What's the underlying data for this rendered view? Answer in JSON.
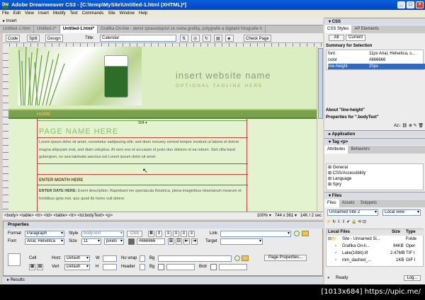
{
  "app": {
    "title": "Adobe Dreamweaver CS3 - [C:\\temp\\MySite\\Untitled-1.html (XHTML)*]",
    "menu": [
      "File",
      "Edit",
      "View",
      "Insert",
      "Modify",
      "Text",
      "Commands",
      "Site",
      "Window",
      "Help"
    ],
    "insert_bar": "Insert"
  },
  "doc_tabs": [
    {
      "label": "Untitled-1.html"
    },
    {
      "label": "Untitled-2*"
    },
    {
      "label": "Untitled-1.html*"
    },
    {
      "label": "Grafika On-line - denni zpravodajstvi ze sveta grafiky, polygrafie a digitalni fotografie h"
    }
  ],
  "doc_toolbar": {
    "code": "Code",
    "split": "Split",
    "design": "Design",
    "title_label": "Title:",
    "title_value": "Calendar",
    "check_page": "Check Page"
  },
  "page": {
    "site_name": "insert website name",
    "tagline": "OPTIONAL TAGLINE HERE",
    "nav_home": "HOME",
    "width_readout": "504 ▾",
    "page_name": "PAGE NAME HERE",
    "lorem": "Lorem ipsum dolor sit amet, consetetur sadipscing elitr, sed diam nonumy eirmod tempor invidunt ut labore et dolore magna aliquyam erat, sed diam voluptua. At vero eos et accusam et justo duo dolores et ea rebum. Stet clita kasd gubergren, no sea takimata sanctus est Lorem ipsum dolor sit amet.",
    "month_head": "ENTER MONTH HERE",
    "date_label": "ENTER DATE HERE:",
    "date_text": "Event description. Rapiebant me spectacula theatrica, plena imaginibus miseriarum mearum et fomitibus ignis mei. quo quod ibi homo vult dolere"
  },
  "status": {
    "tags": "<body> <table> <tr> <td> <table> <tr> <td.bodyText> <p>",
    "zoom": "100%",
    "size": "744 x 361",
    "weight": "14K / 2 sec"
  },
  "properties": {
    "title": "Properties",
    "format_label": "Format",
    "format": "Paragraph",
    "style_label": "Style",
    "style": "bodyText",
    "css_btn": "CSS",
    "link_label": "Link",
    "font_label": "Font",
    "font": "Arial, Helvetica",
    "size_label": "Size",
    "size": "11",
    "unit": "pixels",
    "color": "#666666",
    "target_label": "Target",
    "cell_label": "Cell",
    "horz_label": "Horz",
    "horz": "Default",
    "w_label": "W",
    "nowrap_label": "No wrap",
    "bg_label": "Bg",
    "page_props": "Page Properties...",
    "vert_label": "Vert",
    "vert": "Default",
    "h_label": "H",
    "header_label": "Header",
    "bg2_label": "Bg",
    "brdr_label": "Brdr",
    "results": "Results"
  },
  "css_panel": {
    "title": "CSS",
    "tabs": [
      "CSS Styles",
      "AP Elements"
    ],
    "mode": [
      "All",
      "Current"
    ],
    "summary_title": "Summary for Selection",
    "summary": [
      {
        "k": "font",
        "v": "11px Arial, Helvetica, s..."
      },
      {
        "k": "color",
        "v": "#666666"
      },
      {
        "k": "line-height",
        "v": "20px"
      }
    ],
    "about": "About \"line-height\"",
    "props_for": "Properties for \".bodyText\""
  },
  "application_panel": "Application",
  "tag_panel": {
    "title": "Tag <p>",
    "tabs": [
      "Attributes",
      "Behaviors"
    ],
    "groups": [
      "General",
      "CSS/Accessibility",
      "Language",
      "Spry"
    ]
  },
  "files_panel": {
    "title": "Files",
    "tabs": [
      "Files",
      "Assets",
      "Snippets"
    ],
    "site": "Unnamed Site 2",
    "view": "Local view",
    "headers": [
      "Local Files",
      "Size",
      "Type"
    ],
    "rows": [
      {
        "name": "Site - Unnamed Si...",
        "size": "",
        "type": "Folde"
      },
      {
        "name": "Grafika On-li...",
        "size": "94KB",
        "type": "Oper"
      },
      {
        "name": "Lake(16bit).tif",
        "size": "2.47MB",
        "type": "TIF I"
      },
      {
        "name": "mm_dashed_...",
        "size": "1KB",
        "type": "GIF I"
      }
    ],
    "status": "Ready",
    "log": "Log..."
  },
  "footer": "[1013x684] https://upic.me/"
}
